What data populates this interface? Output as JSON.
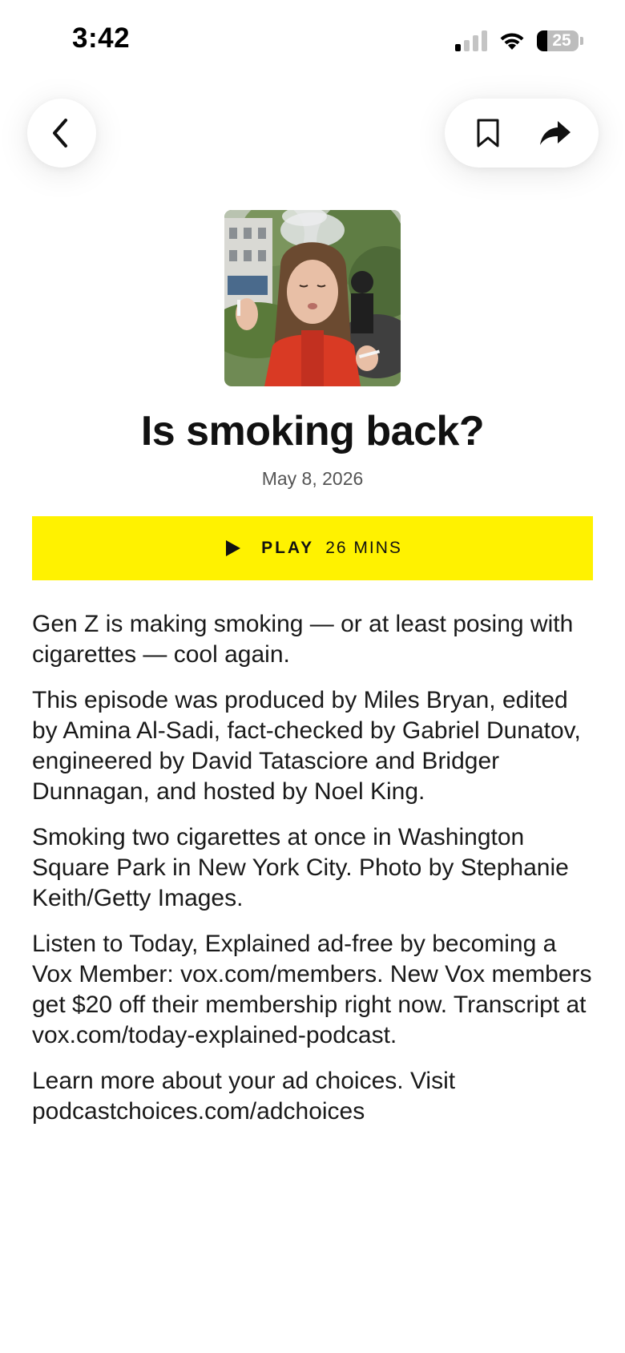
{
  "status_bar": {
    "time": "3:42",
    "battery_level": "25",
    "battery_fraction": 0.25,
    "signal_bars_active": 1,
    "signal_bars_total": 4
  },
  "nav": {
    "back_icon": "chevron-left-icon",
    "bookmark_icon": "bookmark-icon",
    "share_icon": "share-arrow-icon"
  },
  "episode": {
    "title": "Is smoking back?",
    "date": "May 8, 2026",
    "play_label": "PLAY",
    "duration": "26 MINS",
    "description": [
      "Gen Z is making smoking — or at least posing with cigarettes — cool again.",
      "This episode was produced by Miles Bryan, edited by Amina Al-Sadi, fact-checked by Gabriel Dunatov, engineered by David Tatasciore and Bridger Dunnagan, and hosted by Noel King.",
      "Smoking two cigarettes at once in Washington Square Park in New York City. Photo by Stephanie Keith/Getty Images.",
      "Listen to Today, Explained ad-free by becoming a Vox Member: vox.com/members. New Vox members get $20 off their membership right now. Transcript at vox.com/today-explained-podcast.",
      "Learn more about your ad choices. Visit podcastchoices.com/adchoices"
    ]
  },
  "colors": {
    "play_button": "#fff200",
    "text": "#1a1a1a",
    "date": "#555555"
  }
}
